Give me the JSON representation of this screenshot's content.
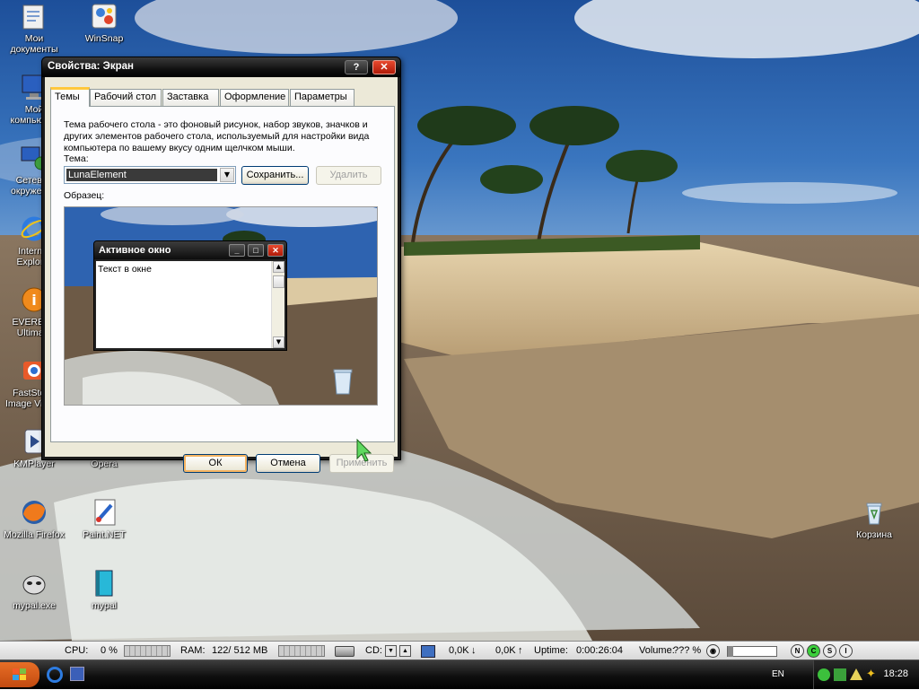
{
  "desktop": {
    "icons": [
      {
        "label": "Мои\nдокументы",
        "icon": "folder-documents-icon"
      },
      {
        "label": "WinSnap",
        "icon": "winsnap-icon"
      },
      {
        "label": "Мой\nкомпьютер",
        "icon": "computer-icon"
      },
      {
        "label": "Сетевое\nокружение",
        "icon": "network-icon"
      },
      {
        "label": "Internet\nExplorer",
        "icon": "internet-explorer-icon"
      },
      {
        "label": "EVEREST\nUltimate",
        "icon": "everest-icon"
      },
      {
        "label": "FastStone\nImage Viewer",
        "icon": "faststone-icon"
      },
      {
        "label": "KMPlayer",
        "icon": "kmplayer-icon"
      },
      {
        "label": "Opera",
        "icon": "opera-icon"
      },
      {
        "label": "Mozilla Firefox",
        "icon": "firefox-icon"
      },
      {
        "label": "Paint.NET",
        "icon": "paintnet-icon"
      },
      {
        "label": "mypal.exe",
        "icon": "mypal-exe-icon"
      },
      {
        "label": "mypal",
        "icon": "mypal-icon"
      },
      {
        "label": "Корзина",
        "icon": "recycle-bin-icon"
      }
    ]
  },
  "dialog": {
    "title": "Свойства: Экран",
    "help_glyph": "?",
    "close_glyph": "✕",
    "tabs": [
      "Темы",
      "Рабочий стол",
      "Заставка",
      "Оформление",
      "Параметры"
    ],
    "active_tab": "Темы",
    "description": "Тема рабочего стола - это фоновый рисунок, набор звуков, значков и других элементов рабочего стола, используемый для настройки вида компьютера по вашему вкусу одним щелчком мыши.",
    "theme_label": "Тема:",
    "theme_value": "LunaElement",
    "save_button": "Сохранить...",
    "delete_button": "Удалить",
    "sample_label": "Образец:",
    "preview": {
      "window_title": "Активное окно",
      "window_text": "Текст в окне"
    },
    "ok_button": "ОК",
    "cancel_button": "Отмена",
    "apply_button": "Применить"
  },
  "monitor_bar": {
    "cpu_label": "CPU:",
    "cpu_value": "0 %",
    "ram_label": "RAM:",
    "ram_value": "122/ 512 MB",
    "cd_label": "CD:",
    "down_value": "0,0K",
    "up_value": "0,0K",
    "uptime_label": "Uptime:",
    "uptime_value": "0:00:26:04",
    "volume_label": "Volume:",
    "volume_value": "??? %",
    "mode_buttons": [
      "N",
      "C",
      "S",
      "I"
    ]
  },
  "taskbar": {
    "language": "EN",
    "clock": "18:28"
  },
  "colors": {
    "accent_tab": "#ffc83c",
    "close_red": "#d43418",
    "dialog_face": "#ece9d8"
  }
}
